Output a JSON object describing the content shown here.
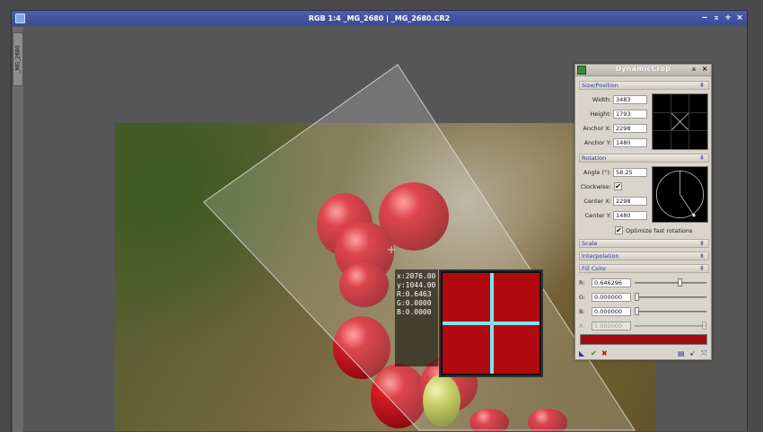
{
  "window": {
    "title": "RGB 1:4 _MG_2680 | _MG_2680.CR2",
    "side_tab_label": "_MG_2680",
    "controls": [
      "‒",
      "⌅",
      "+",
      "×"
    ]
  },
  "readout": {
    "x": "x:2076.00",
    "y": "y:1044.00",
    "r": "R:0.6463",
    "g": "G:0.0000",
    "b": "B:0.0000"
  },
  "panel": {
    "title": "DynamicCrop",
    "controls": [
      "⌅",
      "×"
    ],
    "size_position": {
      "header": "Size/Position",
      "width_label": "Width:",
      "width": "3483",
      "height_label": "Height:",
      "height": "1793",
      "anchor_x_label": "Anchor X:",
      "anchor_x": "2298",
      "anchor_y_label": "Anchor Y:",
      "anchor_y": "1480"
    },
    "rotation": {
      "header": "Rotation",
      "angle_label": "Angle (°):",
      "angle": "58.25",
      "clockwise_label": "Clockwise:",
      "clockwise": true,
      "center_x_label": "Center X:",
      "center_x": "2298",
      "center_y_label": "Center Y:",
      "center_y": "1480",
      "optimize_label": "Optimize fast rotations",
      "optimize": true
    },
    "scale": {
      "header": "Scale"
    },
    "interpolation": {
      "header": "Interpolation"
    },
    "fill_color": {
      "header": "Fill Color",
      "r_label": "R:",
      "r": "0.646296",
      "r_level": 0.646,
      "g_label": "G:",
      "g": "0.000000",
      "g_level": 0.0,
      "b_label": "B:",
      "b": "0.000000",
      "b_level": 0.0,
      "a_label": "A:",
      "a": "1.000000",
      "a_level": 1.0,
      "swatch_color": "#a5090f"
    }
  },
  "colors": {
    "accent": "#2a3a9a",
    "titlebar": "#3a4a94",
    "fill": "#a5090f",
    "cursor_line": "#7fe3f0"
  }
}
